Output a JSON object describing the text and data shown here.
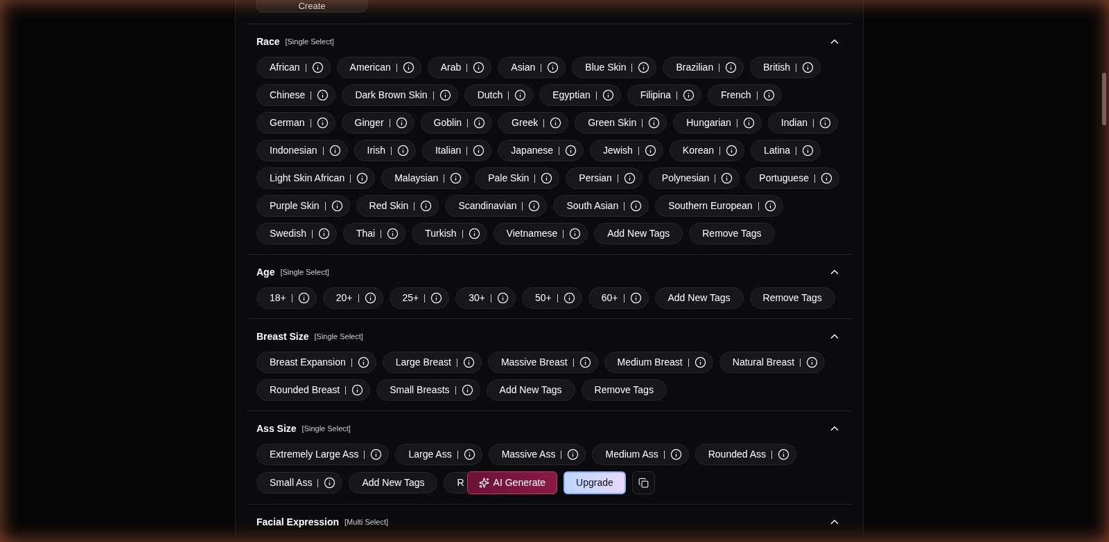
{
  "create_button": "Create",
  "sections": [
    {
      "title": "Race",
      "mode": "[Single Select]",
      "expanded": true,
      "tags": [
        {
          "kind": "tag",
          "label": "African"
        },
        {
          "kind": "tag",
          "label": "American"
        },
        {
          "kind": "tag",
          "label": "Arab"
        },
        {
          "kind": "tag",
          "label": "Asian"
        },
        {
          "kind": "tag",
          "label": "Blue Skin"
        },
        {
          "kind": "tag",
          "label": "Brazilian"
        },
        {
          "kind": "tag",
          "label": "British"
        },
        {
          "kind": "tag",
          "label": "Chinese"
        },
        {
          "kind": "tag",
          "label": "Dark Brown Skin"
        },
        {
          "kind": "tag",
          "label": "Dutch"
        },
        {
          "kind": "tag",
          "label": "Egyptian"
        },
        {
          "kind": "tag",
          "label": "Filipina"
        },
        {
          "kind": "tag",
          "label": "French"
        },
        {
          "kind": "tag",
          "label": "German"
        },
        {
          "kind": "tag",
          "label": "Ginger"
        },
        {
          "kind": "tag",
          "label": "Goblin"
        },
        {
          "kind": "tag",
          "label": "Greek"
        },
        {
          "kind": "tag",
          "label": "Green Skin"
        },
        {
          "kind": "tag",
          "label": "Hungarian"
        },
        {
          "kind": "tag",
          "label": "Indian"
        },
        {
          "kind": "tag",
          "label": "Indonesian"
        },
        {
          "kind": "tag",
          "label": "Irish"
        },
        {
          "kind": "tag",
          "label": "Italian"
        },
        {
          "kind": "tag",
          "label": "Japanese"
        },
        {
          "kind": "tag",
          "label": "Jewish"
        },
        {
          "kind": "tag",
          "label": "Korean"
        },
        {
          "kind": "tag",
          "label": "Latina"
        },
        {
          "kind": "tag",
          "label": "Light Skin African"
        },
        {
          "kind": "tag",
          "label": "Malaysian"
        },
        {
          "kind": "tag",
          "label": "Pale Skin"
        },
        {
          "kind": "tag",
          "label": "Persian"
        },
        {
          "kind": "tag",
          "label": "Polynesian"
        },
        {
          "kind": "tag",
          "label": "Portuguese"
        },
        {
          "kind": "tag",
          "label": "Purple Skin"
        },
        {
          "kind": "tag",
          "label": "Red Skin"
        },
        {
          "kind": "tag",
          "label": "Scandinavian"
        },
        {
          "kind": "tag",
          "label": "South Asian"
        },
        {
          "kind": "tag",
          "label": "Southern European"
        },
        {
          "kind": "tag",
          "label": "Swedish"
        },
        {
          "kind": "tag",
          "label": "Thai"
        },
        {
          "kind": "tag",
          "label": "Turkish"
        },
        {
          "kind": "tag",
          "label": "Vietnamese"
        },
        {
          "kind": "action",
          "label": "Add New Tags"
        },
        {
          "kind": "action",
          "label": "Remove Tags"
        }
      ]
    },
    {
      "title": "Age",
      "mode": "[Single Select]",
      "expanded": true,
      "tags": [
        {
          "kind": "tag",
          "label": "18+"
        },
        {
          "kind": "tag",
          "label": "20+"
        },
        {
          "kind": "tag",
          "label": "25+"
        },
        {
          "kind": "tag",
          "label": "30+"
        },
        {
          "kind": "tag",
          "label": "50+"
        },
        {
          "kind": "tag",
          "label": "60+"
        },
        {
          "kind": "action",
          "label": "Add New Tags"
        },
        {
          "kind": "action",
          "label": "Remove Tags"
        }
      ]
    },
    {
      "title": "Breast Size",
      "mode": "[Single Select]",
      "expanded": true,
      "tags": [
        {
          "kind": "tag",
          "label": "Breast Expansion"
        },
        {
          "kind": "tag",
          "label": "Large Breast"
        },
        {
          "kind": "tag",
          "label": "Massive Breast"
        },
        {
          "kind": "tag",
          "label": "Medium Breast"
        },
        {
          "kind": "tag",
          "label": "Natural Breast"
        },
        {
          "kind": "tag",
          "label": "Rounded Breast"
        },
        {
          "kind": "tag",
          "label": "Small Breasts"
        },
        {
          "kind": "action",
          "label": "Add New Tags"
        },
        {
          "kind": "action",
          "label": "Remove Tags"
        }
      ]
    },
    {
      "title": "Ass Size",
      "mode": "[Single Select]",
      "expanded": true,
      "toolbar": true,
      "tags": [
        {
          "kind": "tag",
          "label": "Extremely Large Ass"
        },
        {
          "kind": "tag",
          "label": "Large Ass"
        },
        {
          "kind": "tag",
          "label": "Massive Ass"
        },
        {
          "kind": "tag",
          "label": "Medium Ass"
        },
        {
          "kind": "tag",
          "label": "Rounded Ass"
        },
        {
          "kind": "tag",
          "label": "Small Ass"
        },
        {
          "kind": "action",
          "label": "Add New Tags"
        },
        {
          "kind": "covered_action",
          "label": "R"
        }
      ]
    },
    {
      "title": "Facial Expression",
      "mode": "[Multi Select]",
      "expanded": true
    }
  ],
  "toolbar": {
    "generate": "AI Generate",
    "upgrade": "Upgrade"
  }
}
